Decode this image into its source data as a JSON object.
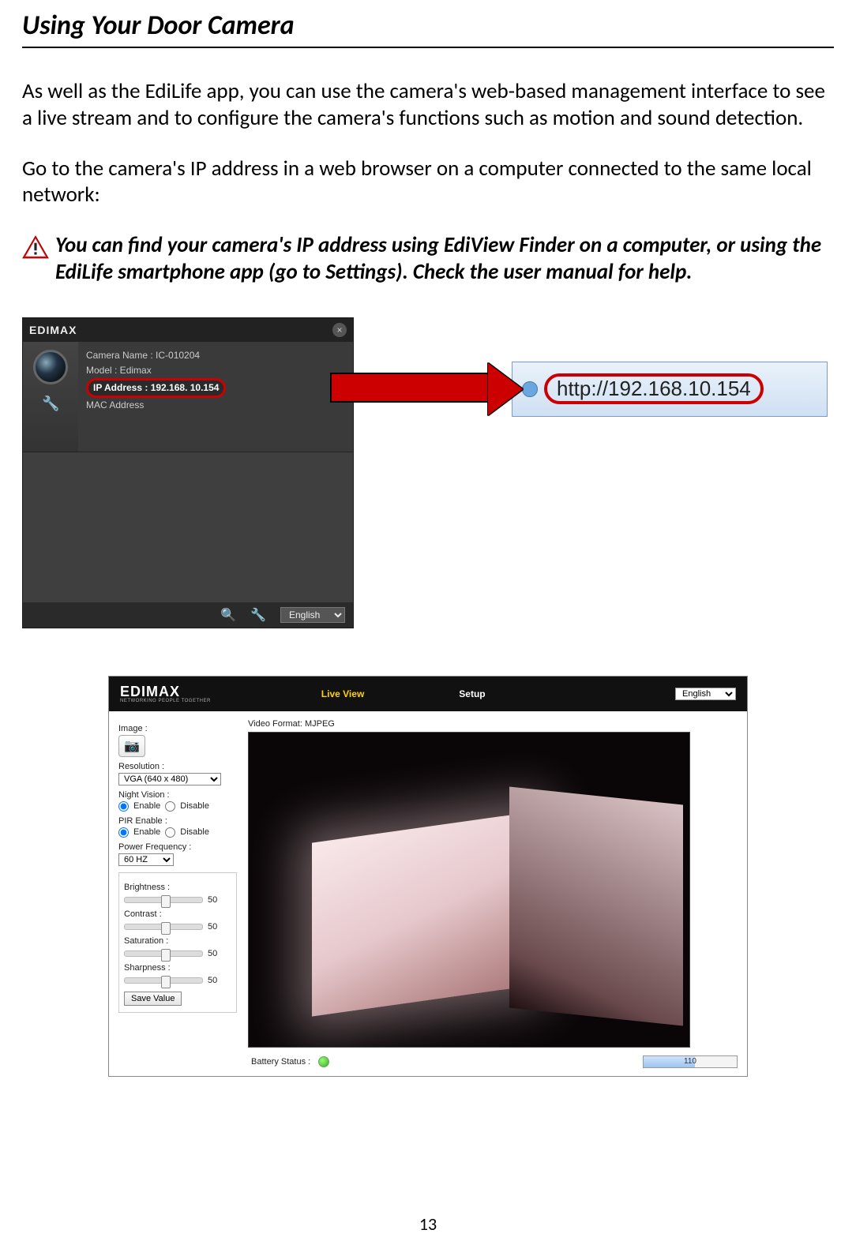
{
  "doc": {
    "title": "Using Your Door Camera",
    "para1": "As well as the EdiLife app, you can use the camera's web-based management interface to see a live stream and to configure the camera's functions such as motion and sound detection.",
    "para2": "Go to the camera's IP address in a web browser on a computer connected to the same local network:",
    "note": "You can find your camera's IP address using EdiView Finder on a computer, or using the EdiLife smartphone app (go to Settings). Check the user manual for help.",
    "page_number": "13"
  },
  "finder": {
    "logo": "EDIMAX",
    "camera_name_label": "Camera Name : IC-010204",
    "model_label": "Model : Edimax",
    "ip_label": "IP Address : 192.168. 10.154",
    "mac_label": "MAC Address",
    "language": "English"
  },
  "url_bar": {
    "url": "http://192.168.10.154"
  },
  "webui": {
    "logo": "EDIMAX",
    "logo_sub": "NETWORKING PEOPLE TOGETHER",
    "tab_live": "Live View",
    "tab_setup": "Setup",
    "language": "English",
    "image_label": "Image :",
    "video_format_label": "Video Format:  MJPEG",
    "resolution_label": "Resolution :",
    "resolution_value": "VGA (640 x 480)",
    "night_vision_label": "Night Vision :",
    "pir_label": "PIR Enable :",
    "enable": "Enable",
    "disable": "Disable",
    "power_freq_label": "Power Frequency :",
    "power_freq_value": "60 HZ",
    "brightness_label": "Brightness :",
    "contrast_label": "Contrast :",
    "saturation_label": "Saturation :",
    "sharpness_label": "Sharpness :",
    "slider_value": "50",
    "save_label": "Save Value",
    "battery_label": "Battery Status :",
    "battery_value": "110"
  }
}
